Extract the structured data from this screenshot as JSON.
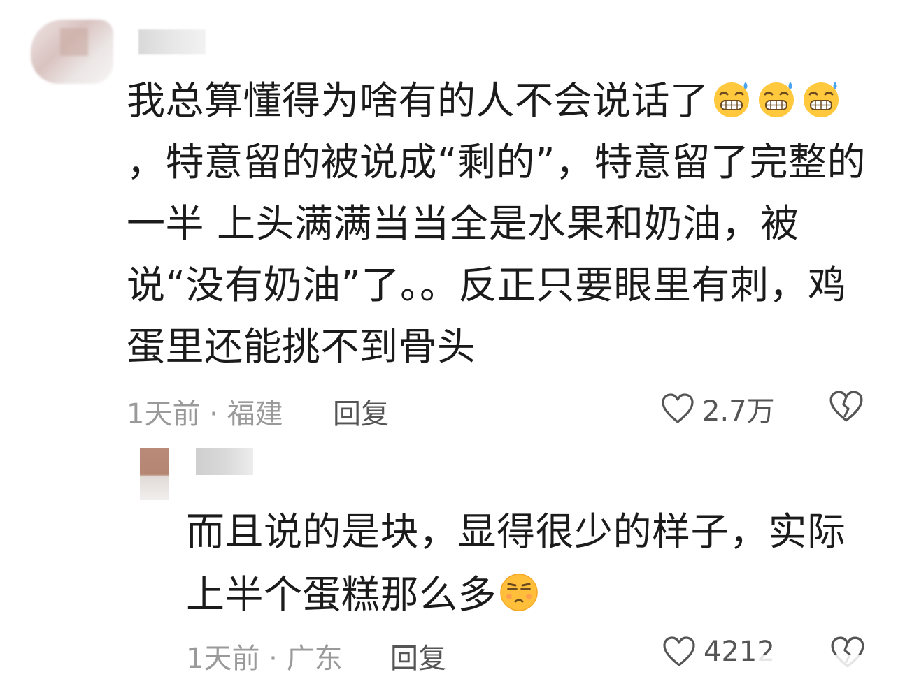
{
  "comment1": {
    "text_part1": "我总算懂得为啥有的人不会说话了",
    "text_part2": "，特意留的被说成“剩的”，特意留了完整的一半 上头满满当当全是水果和奶油，被说“没有奶油”了。。反正只要眼里有刺，鸡蛋里还能挑不到骨头",
    "time_location": "1天前 · 福建",
    "reply_label": "回复",
    "like_count": "2.7万",
    "emoji_name": "grimacing-sweat-emoji"
  },
  "comment2": {
    "text": "而且说的是块，显得很少的样子，实际上半个蛋糕那么多",
    "time_location": "1天前 · 广东",
    "reply_label": "回复",
    "like_count": "4212",
    "emoji_name": "unamused-face-emoji"
  },
  "colors": {
    "text": "#1b1b1b",
    "meta": "#9a9a9a",
    "action": "#555555",
    "emoji_yellow": "#ffc83d"
  }
}
